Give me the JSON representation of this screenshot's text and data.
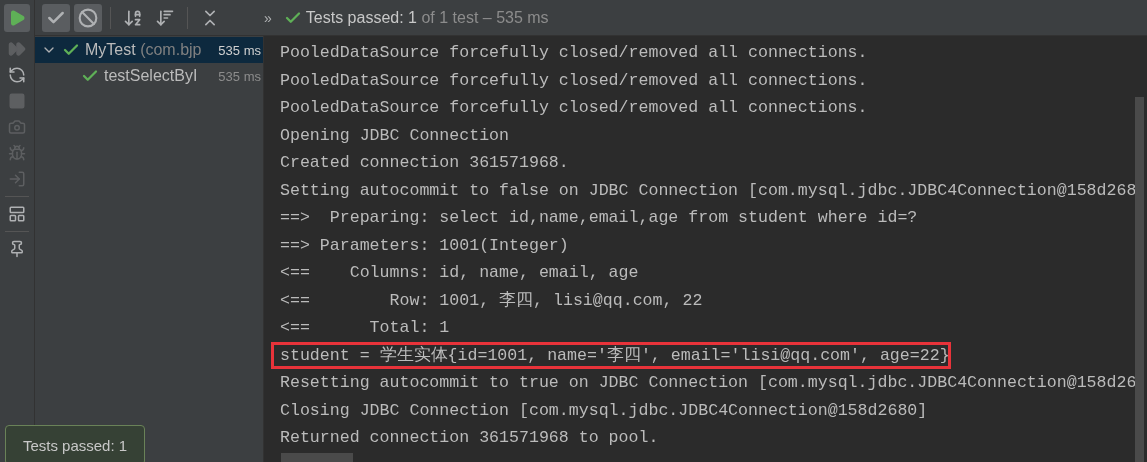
{
  "toolbar": {
    "buttons": [
      {
        "kind": "check",
        "selected": true
      },
      {
        "kind": "ban",
        "selected": true
      },
      {
        "kind": "sort-alpha",
        "selected": false
      },
      {
        "kind": "sort-duration",
        "selected": false
      },
      {
        "kind": "expand",
        "selected": false
      }
    ],
    "more": "»",
    "status": {
      "passed": "Tests passed: 1",
      "rest": " of 1 test – 535 ms"
    }
  },
  "side_toolbar": [
    {
      "kind": "play"
    },
    {
      "kind": "rerun-failed"
    },
    {
      "kind": "toggle-auto"
    },
    {
      "kind": "stop"
    },
    {
      "kind": "camera"
    },
    {
      "kind": "bug"
    },
    {
      "kind": "import"
    },
    {
      "kind": "separator"
    },
    {
      "kind": "layout"
    },
    {
      "kind": "separator"
    },
    {
      "kind": "pin"
    }
  ],
  "tree": [
    {
      "name": "MyTest",
      "package": "(com.bjp",
      "time": "535 ms",
      "passed": true,
      "selected": true,
      "expanded": true,
      "children": [
        {
          "name": "testSelectByI",
          "time": "535 ms",
          "passed": true,
          "selected": false
        }
      ]
    }
  ],
  "console": [
    {
      "text": "PooledDataSource forcefully closed/removed all connections.",
      "boxed": false
    },
    {
      "text": "PooledDataSource forcefully closed/removed all connections.",
      "boxed": false
    },
    {
      "text": "PooledDataSource forcefully closed/removed all connections.",
      "boxed": false
    },
    {
      "text": "Opening JDBC Connection",
      "boxed": false
    },
    {
      "text": "Created connection 361571968.",
      "boxed": false
    },
    {
      "text": "Setting autocommit to false on JDBC Connection [com.mysql.jdbc.JDBC4Connection@158d268",
      "boxed": false
    },
    {
      "text": "==>  Preparing: select id,name,email,age from student where id=?",
      "boxed": false
    },
    {
      "text": "==> Parameters: 1001(Integer)",
      "boxed": false
    },
    {
      "text": "<==    Columns: id, name, email, age",
      "boxed": false
    },
    {
      "text": "<==        Row: 1001, 李四, lisi@qq.com, 22",
      "boxed": false
    },
    {
      "text": "<==      Total: 1",
      "boxed": false
    },
    {
      "text": "student = 学生实体{id=1001, name='李四', email='lisi@qq.com', age=22}",
      "boxed": true
    },
    {
      "text": "Resetting autocommit to true on JDBC Connection [com.mysql.jdbc.JDBC4Connection@158d26",
      "boxed": false
    },
    {
      "text": "Closing JDBC Connection [com.mysql.jdbc.JDBC4Connection@158d2680]",
      "boxed": false
    },
    {
      "text": "Returned connection 361571968 to pool.",
      "boxed": false
    }
  ],
  "toast": {
    "text": "Tests passed: 1"
  }
}
